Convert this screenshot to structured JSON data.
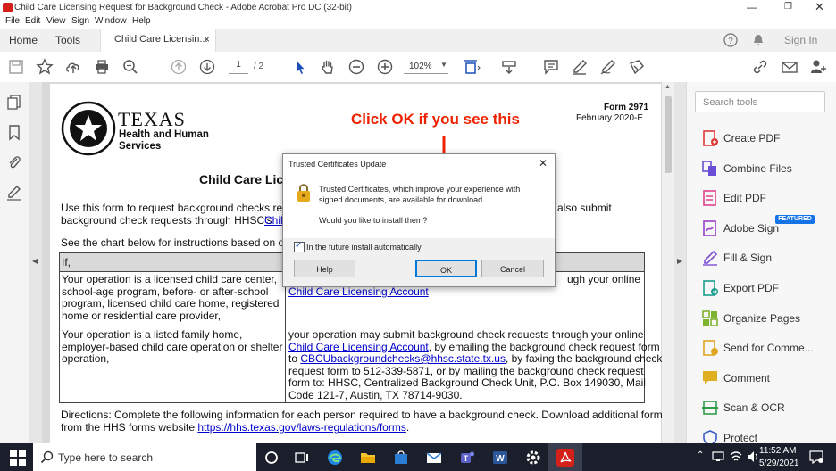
{
  "window": {
    "title": "Child Care Licensing Request for Background Check - Adobe Acrobat Pro DC (32-bit)"
  },
  "menu": [
    "File",
    "Edit",
    "View",
    "Sign",
    "Window",
    "Help"
  ],
  "tabs": {
    "home": "Home",
    "tools": "Tools",
    "document": "Child Care Licensin...",
    "close": "×"
  },
  "account": {
    "sign_in": "Sign In"
  },
  "toolbar": {
    "page_current": "1",
    "page_total": "/ 2",
    "zoom": "102%"
  },
  "document": {
    "logo_line1": "TEXAS",
    "logo_line2": "Health and Human",
    "logo_line3": "Services",
    "form_number": "Form 2971",
    "form_date": "February 2020-E",
    "heading": "Child Care Lic",
    "intro_a": "Use this form to request background checks requ",
    "intro_b": "also submit",
    "intro_c": "background check requests through HHSC’s",
    "intro_c_link": "Chil",
    "see_chart": "See the chart below for instructions based on ope",
    "table_header_if": "If,",
    "row1_left": "Your operation is a licensed child care center, school-age program, before- or after-school program, licensed child care home, registered home or residential care provider,",
    "row1_right_a": "ugh your online",
    "row1_right_link": "Child Care Licensing Account",
    "row2_left": "Your operation is a listed family home, employer-based child care operation or shelter operation,",
    "row2_right_1": "your operation may submit background check requests through your online",
    "row2_right_link1": "Child Care Licensing Account",
    "row2_right_2": ", by emailing the background check request form",
    "row2_right_3": "to ",
    "row2_right_link2": "CBCUbackgroundchecks@hhsc.state.tx.us",
    "row2_right_4": ", by faxing the background check",
    "row2_right_5": "request form to 512-339-5871, or by mailing the background check request",
    "row2_right_6": "form to: HHSC, Centralized Background Check Unit, P.O. Box 149030, Mail",
    "row2_right_7": "Code 121-7, Austin, TX 78714-9030.",
    "directions_1": "Directions: Complete the following information for each person required to have a background check. Download additional forms",
    "directions_2": "from the HHS forms website ",
    "directions_link": "https://hhs.texas.gov/laws-regulations/forms",
    "directions_end": "."
  },
  "dialog": {
    "title": "Trusted Certificates Update",
    "message": "Trusted Certificates, which improve your experience with signed documents, are available for download",
    "question": "Would you like to install them?",
    "checkbox_label": "In the future install automatically",
    "help": "Help",
    "ok": "OK",
    "cancel": "Cancel"
  },
  "annotation": "Click OK if you see this",
  "tools_pane": {
    "search_placeholder": "Search tools",
    "featured": "FEATURED",
    "items": [
      {
        "label": "Create PDF",
        "color": "#e03a3a"
      },
      {
        "label": "Combine Files",
        "color": "#6a4fd6"
      },
      {
        "label": "Edit PDF",
        "color": "#e0408a"
      },
      {
        "label": "Adobe Sign",
        "color": "#9a3fc8"
      },
      {
        "label": "Fill & Sign",
        "color": "#7b4fd6"
      },
      {
        "label": "Export PDF",
        "color": "#1a9d8f"
      },
      {
        "label": "Organize Pages",
        "color": "#7cb32f"
      },
      {
        "label": "Send for Comme...",
        "color": "#e0a620"
      },
      {
        "label": "Comment",
        "color": "#e0b020"
      },
      {
        "label": "Scan & OCR",
        "color": "#2e9d4a"
      },
      {
        "label": "Protect",
        "color": "#3a5cc8"
      }
    ]
  },
  "taskbar": {
    "search_placeholder": "Type here to search",
    "time": "11:52 AM",
    "date": "5/29/2021"
  }
}
